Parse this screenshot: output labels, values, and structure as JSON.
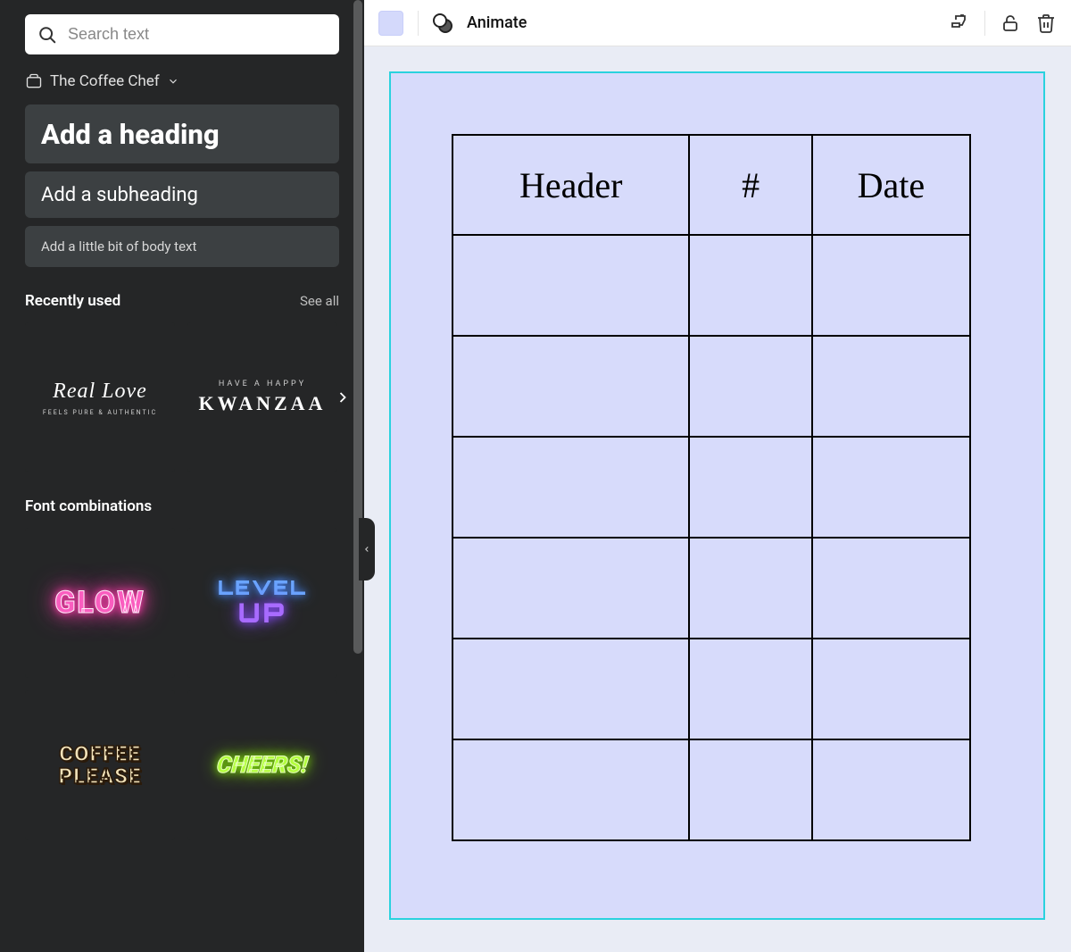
{
  "sidebar": {
    "search_placeholder": "Search text",
    "brand_name": "The Coffee Chef",
    "heading_label": "Add a heading",
    "subheading_label": "Add a subheading",
    "body_label": "Add a little bit of body text",
    "recently_used": {
      "title": "Recently used",
      "see_all": "See all",
      "tiles": [
        {
          "line1": "Real Love",
          "line2": "FEELS PURE & AUTHENTIC"
        },
        {
          "line1": "HAVE A HAPPY",
          "line2": "KWANZAA"
        }
      ]
    },
    "font_combinations": {
      "title": "Font combinations",
      "tiles": [
        {
          "label": "GLOW"
        },
        {
          "line1": "LEVEL",
          "line2": "UP"
        },
        {
          "line1": "COFFEE",
          "line2": "PLEASE"
        },
        {
          "label": "CHEERS!"
        }
      ]
    }
  },
  "topbar": {
    "swatch_color": "#d4d9fb",
    "animate_label": "Animate"
  },
  "canvas": {
    "table": {
      "headers": [
        "Header",
        "#",
        "Date"
      ],
      "body_rows": 6
    }
  }
}
